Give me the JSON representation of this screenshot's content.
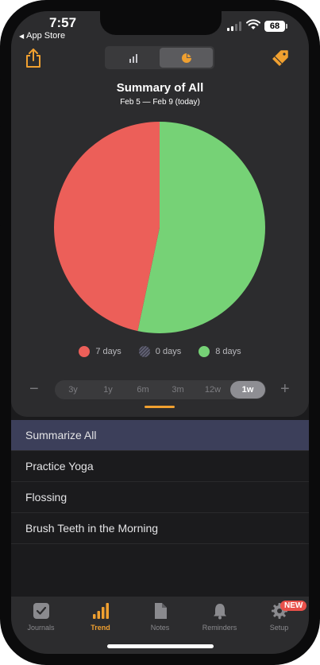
{
  "status_bar": {
    "time": "7:57",
    "back_app": "App Store",
    "battery": "68"
  },
  "header": {
    "segments": [
      {
        "icon": "bar-chart-icon",
        "active": false
      },
      {
        "icon": "pie-chart-icon",
        "active": true
      }
    ]
  },
  "summary": {
    "title": "Summary of All",
    "date_range": "Feb 5 — Feb 9 (today)"
  },
  "chart_data": {
    "type": "pie",
    "slices": [
      {
        "label": "7 days",
        "value": 7,
        "color": "#ec5f59"
      },
      {
        "label": "0 days",
        "value": 0,
        "color": "#4a4a5a"
      },
      {
        "label": "8 days",
        "value": 8,
        "color": "#76d276"
      }
    ]
  },
  "legend": [
    {
      "label": "7 days",
      "color": "#ec5f59"
    },
    {
      "label": "0 days",
      "color": "#4a4a5a"
    },
    {
      "label": "8 days",
      "color": "#76d276"
    }
  ],
  "range": {
    "minus": "−",
    "plus": "+",
    "options": [
      "3y",
      "1y",
      "6m",
      "3m",
      "12w",
      "1w"
    ],
    "selected": "1w"
  },
  "list": {
    "items": [
      "Summarize All",
      "Practice Yoga",
      "Flossing",
      "Brush Teeth in the Morning"
    ],
    "selected_index": 0
  },
  "tabbar": {
    "tabs": [
      {
        "label": "Journals",
        "icon": "checkbox-icon"
      },
      {
        "label": "Trend",
        "icon": "trend-bars-icon"
      },
      {
        "label": "Notes",
        "icon": "document-icon"
      },
      {
        "label": "Reminders",
        "icon": "bell-icon"
      },
      {
        "label": "Setup",
        "icon": "gear-icon"
      }
    ],
    "active_tab": "Trend",
    "setup_badge": "NEW"
  },
  "colors": {
    "accent": "#f0a030",
    "selected_row": "#3c3f5a"
  }
}
